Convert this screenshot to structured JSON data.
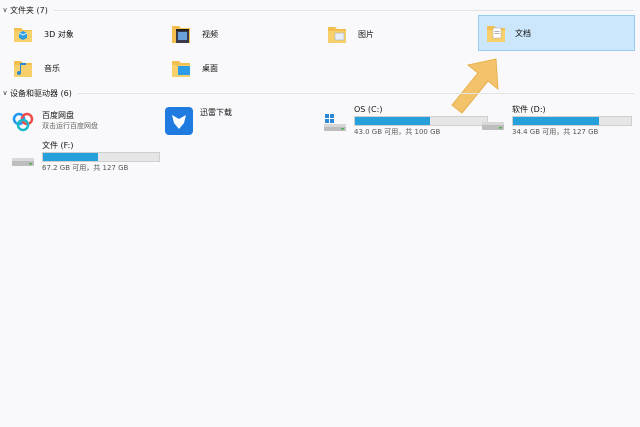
{
  "folders_group": {
    "title": "文件夹 (7)"
  },
  "folders": [
    {
      "label": "3D 对象",
      "icon": "3d-objects-folder-icon",
      "selected": false
    },
    {
      "label": "视频",
      "icon": "videos-folder-icon",
      "selected": false
    },
    {
      "label": "图片",
      "icon": "pictures-folder-icon",
      "selected": false
    },
    {
      "label": "文档",
      "icon": "documents-folder-icon",
      "selected": true
    },
    {
      "label": "音乐",
      "icon": "music-folder-icon",
      "selected": false
    },
    {
      "label": "桌面",
      "icon": "desktop-folder-icon",
      "selected": false
    }
  ],
  "devices_group": {
    "title": "设备和驱动器 (6)"
  },
  "apps": [
    {
      "name": "百度网盘",
      "sub": "双击运行百度网盘",
      "icon": "baidu-netdisk-icon"
    },
    {
      "name": "迅雷下载",
      "icon": "xunlei-download-icon"
    }
  ],
  "drives": [
    {
      "name": "OS (C:)",
      "space": "43.0 GB 可用，共 100 GB",
      "used_fraction": 0.57,
      "icon": "windows-drive-icon"
    },
    {
      "name": "软件 (D:)",
      "space": "34.4 GB 可用，共 127 GB",
      "used_fraction": 0.73,
      "icon": "hard-drive-icon"
    },
    {
      "name": "文件 (F:)",
      "space": "67.2 GB 可用，共 127 GB",
      "used_fraction": 0.47,
      "icon": "hard-drive-icon"
    }
  ],
  "colors": {
    "selection": "#cce6fb",
    "bar_fill": "#26a0da",
    "folder": "#f3c04f",
    "arrow": "#f2c36a"
  }
}
